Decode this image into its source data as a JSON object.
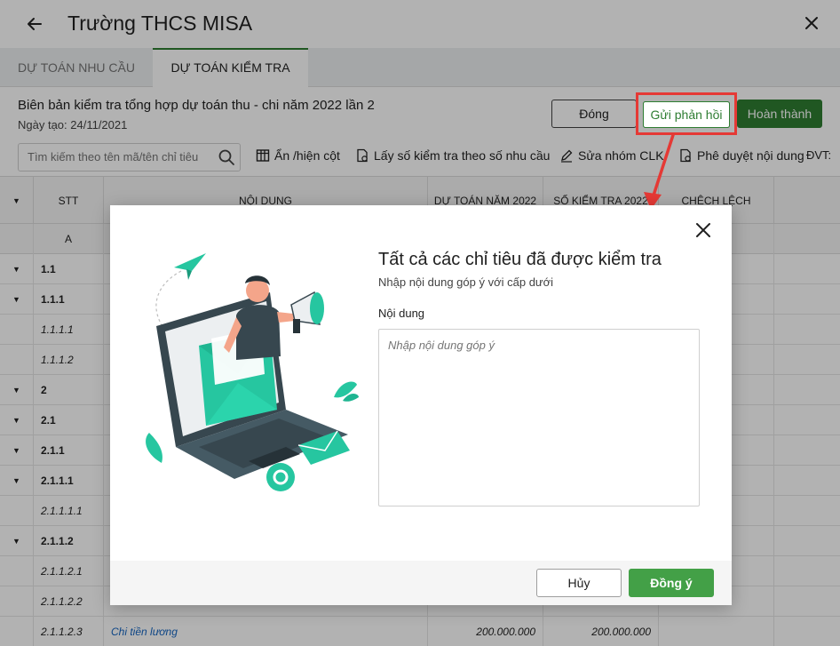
{
  "header": {
    "back_icon": "arrow-left-icon",
    "title": "Trường THCS MISA",
    "close_icon": "close-icon"
  },
  "tabs": [
    {
      "label": "DỰ TOÁN NHU CẦU"
    },
    {
      "label": "DỰ TOÁN KIỂM TRA"
    }
  ],
  "report": {
    "title": "Biên bản kiểm tra tổng hợp dự toán thu - chi năm 2022 lần 2",
    "date": "Ngày tạo: 24/11/2021",
    "close_label": "Đóng",
    "feedback_label": "Gửi phản hồi",
    "complete_label": "Hoàn thành"
  },
  "toolbar": {
    "search_placeholder": "Tìm kiếm theo tên mã/tên chỉ tiêu",
    "toggle_columns": "Ẩn /hiện cột",
    "fetch_check_numbers": "Lấy số kiểm tra theo số nhu cầu",
    "edit_clk_group": "Sửa nhóm CLK",
    "approve_content": "Phê duyệt nội dung",
    "unit_label": "ĐVT:"
  },
  "table": {
    "headers": {
      "stt": "STT",
      "content": "NỘI DUNG",
      "budget": "DỰ TOÁN NĂM 2022",
      "check": "SỐ KIỂM TRA 2022",
      "diff": "CHÊCH LỆCH"
    },
    "subhead_stt": "A",
    "rows": [
      {
        "stt": "1.1"
      },
      {
        "stt": "1.1.1"
      },
      {
        "stt": "1.1.1.1"
      },
      {
        "stt": "1.1.1.2"
      },
      {
        "stt": "2"
      },
      {
        "stt": "2.1"
      },
      {
        "stt": "2.1.1"
      },
      {
        "stt": "2.1.1.1"
      },
      {
        "stt": "2.1.1.1.1"
      },
      {
        "stt": "2.1.1.2"
      },
      {
        "stt": "2.1.1.2.1"
      },
      {
        "stt": "2.1.1.2.2"
      },
      {
        "stt": "2.1.1.2.3",
        "content": "Chi tiền lương",
        "budget": "200.000.000",
        "check": "200.000.000"
      }
    ]
  },
  "modal": {
    "heading": "Tất cả các chỉ tiêu đã được kiểm tra",
    "subtitle": "Nhập nội dung góp ý với cấp dưới",
    "field_label": "Nội dung",
    "textarea_placeholder": "Nhập nội dung góp ý",
    "cancel_label": "Hủy",
    "ok_label": "Đồng ý",
    "close_icon": "close-icon",
    "illustration": "megaphone-laptop-illustration"
  },
  "colors": {
    "accent": "#2e7d32",
    "highlight": "#e53935",
    "illustration": "#26c6a0"
  }
}
